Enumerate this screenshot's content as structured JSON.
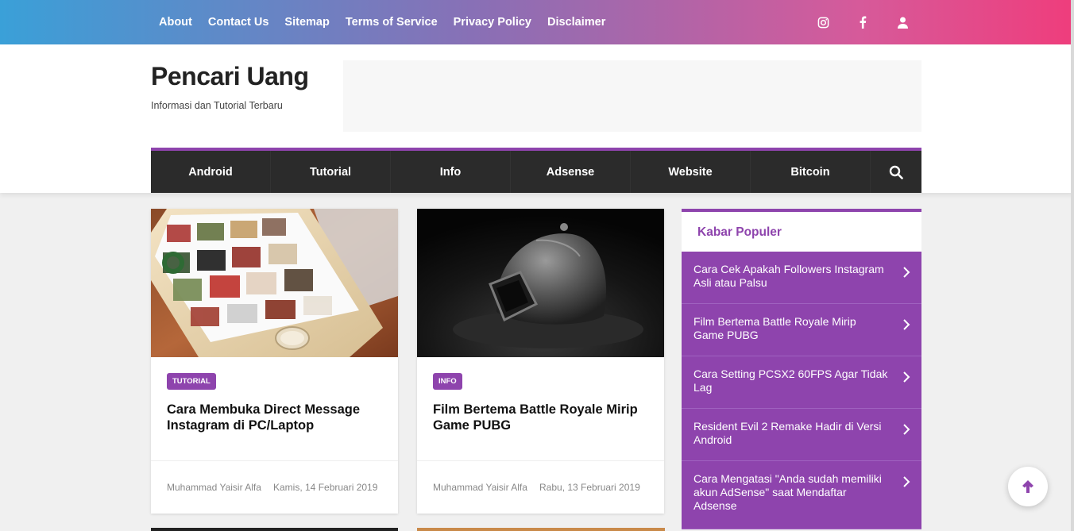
{
  "topnav": [
    "About",
    "Contact Us",
    "Sitemap",
    "Terms of Service",
    "Privacy Policy",
    "Disclaimer"
  ],
  "social_icons": [
    "instagram-icon",
    "facebook-icon",
    "user-icon"
  ],
  "site": {
    "title": "Pencari Uang",
    "tagline": "Informasi dan Tutorial Terbaru"
  },
  "mainnav": [
    "Android",
    "Tutorial",
    "Info",
    "Adsense",
    "Website",
    "Bitcoin"
  ],
  "posts": [
    {
      "label": "TUTORIAL",
      "title": "Cara Membuka Direct Message Instagram di PC/Laptop",
      "author": "Muhammad Yaisir Alfa",
      "date": "Kamis, 14 Februari 2019"
    },
    {
      "label": "INFO",
      "title": "Film Bertema Battle Royale Mirip Game PUBG",
      "author": "Muhammad Yaisir Alfa",
      "date": "Rabu, 13 Februari 2019"
    }
  ],
  "sidebar": {
    "title": "Kabar Populer",
    "items": [
      "Cara Cek Apakah Followers Instagram Asli atau Palsu",
      "Film Bertema Battle Royale Mirip Game PUBG",
      "Cara Setting PCSX2 60FPS Agar Tidak Lag",
      "Resident Evil 2 Remake Hadir di Versi Android",
      "Cara Mengatasi \"Anda sudah memiliki akun AdSense\" saat Mendaftar Adsense"
    ]
  },
  "colors": {
    "accent": "#8e44ad",
    "nav_dark": "#2b2b2b"
  }
}
